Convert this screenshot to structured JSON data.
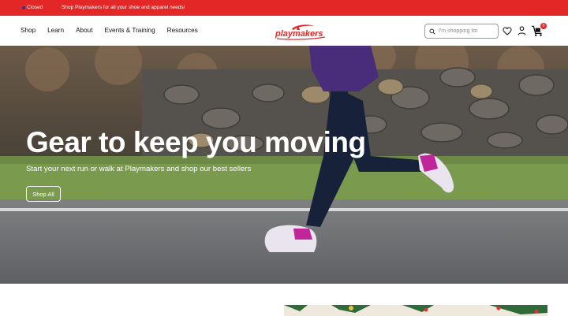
{
  "topbar": {
    "status": "Closed",
    "promo": "Shop Playmakers for all your shoe and apparel needs!",
    "colors": {
      "background": "#e32626",
      "status_dot": "#2c3a8e"
    }
  },
  "nav": {
    "links": [
      {
        "label": "Shop"
      },
      {
        "label": "Learn"
      },
      {
        "label": "About"
      },
      {
        "label": "Events & Training"
      },
      {
        "label": "Resources"
      }
    ],
    "logo_text": "playmakers",
    "search": {
      "placeholder": "I'm shopping for",
      "value": ""
    },
    "icons": [
      "search-icon",
      "heart-icon",
      "account-icon",
      "cart-icon"
    ],
    "cart_count": "0"
  },
  "hero": {
    "headline": "Gear to keep you moving",
    "subtext": "Start your next run or walk at Playmakers and shop our best sellers",
    "cta_label": "Shop All"
  },
  "colors": {
    "brand_red": "#e32626",
    "text": "#111111"
  }
}
